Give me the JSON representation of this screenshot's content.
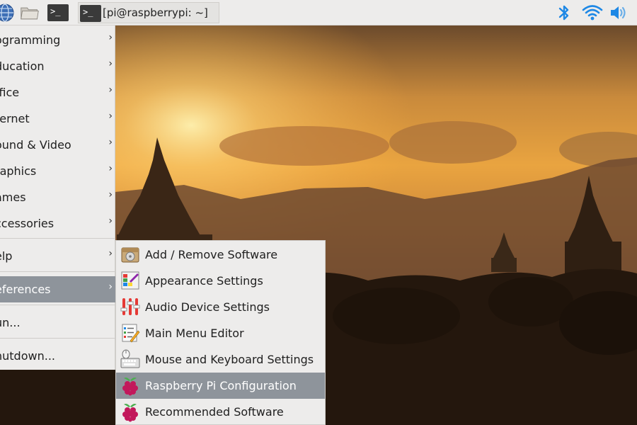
{
  "colors": {
    "menu_bg": "#edeceb",
    "highlight": "#8e949b",
    "bt_blue": "#1e88e5"
  },
  "taskbar": {
    "launchers": [
      {
        "icon": "globe-icon"
      },
      {
        "icon": "folder-icon"
      },
      {
        "icon": "terminal-icon"
      }
    ],
    "task": {
      "icon": "terminal-icon",
      "label": "[pi@raspberrypi: ~]"
    },
    "tray": [
      {
        "icon": "bluetooth-icon"
      },
      {
        "icon": "wifi-icon"
      },
      {
        "icon": "volume-icon"
      }
    ]
  },
  "main_menu": {
    "items": [
      {
        "label": "ogramming",
        "has_submenu": true
      },
      {
        "label": "ducation",
        "has_submenu": true
      },
      {
        "label": "ffice",
        "has_submenu": true
      },
      {
        "label": "ternet",
        "has_submenu": true
      },
      {
        "label": "ound & Video",
        "has_submenu": true
      },
      {
        "label": "raphics",
        "has_submenu": true
      },
      {
        "label": "ames",
        "has_submenu": true
      },
      {
        "label": "ccessories",
        "has_submenu": true
      },
      {
        "label": "elp",
        "has_submenu": true
      },
      {
        "label": "eferences",
        "has_submenu": true,
        "active": true
      },
      {
        "label": "un...",
        "has_submenu": false
      },
      {
        "label": "hutdown...",
        "has_submenu": false
      }
    ],
    "arrow": "›"
  },
  "preferences_submenu": {
    "items": [
      {
        "label": "Add / Remove Software",
        "icon": "package-install-icon"
      },
      {
        "label": "Appearance Settings",
        "icon": "appearance-palette-icon"
      },
      {
        "label": "Audio Device Settings",
        "icon": "audio-mixer-icon"
      },
      {
        "label": "Main Menu Editor",
        "icon": "menu-editor-icon"
      },
      {
        "label": "Mouse and Keyboard Settings",
        "icon": "keyboard-mouse-icon"
      },
      {
        "label": "Raspberry Pi Configuration",
        "icon": "raspberry-icon",
        "active": true
      },
      {
        "label": "Recommended Software",
        "icon": "raspberry-icon"
      }
    ]
  }
}
